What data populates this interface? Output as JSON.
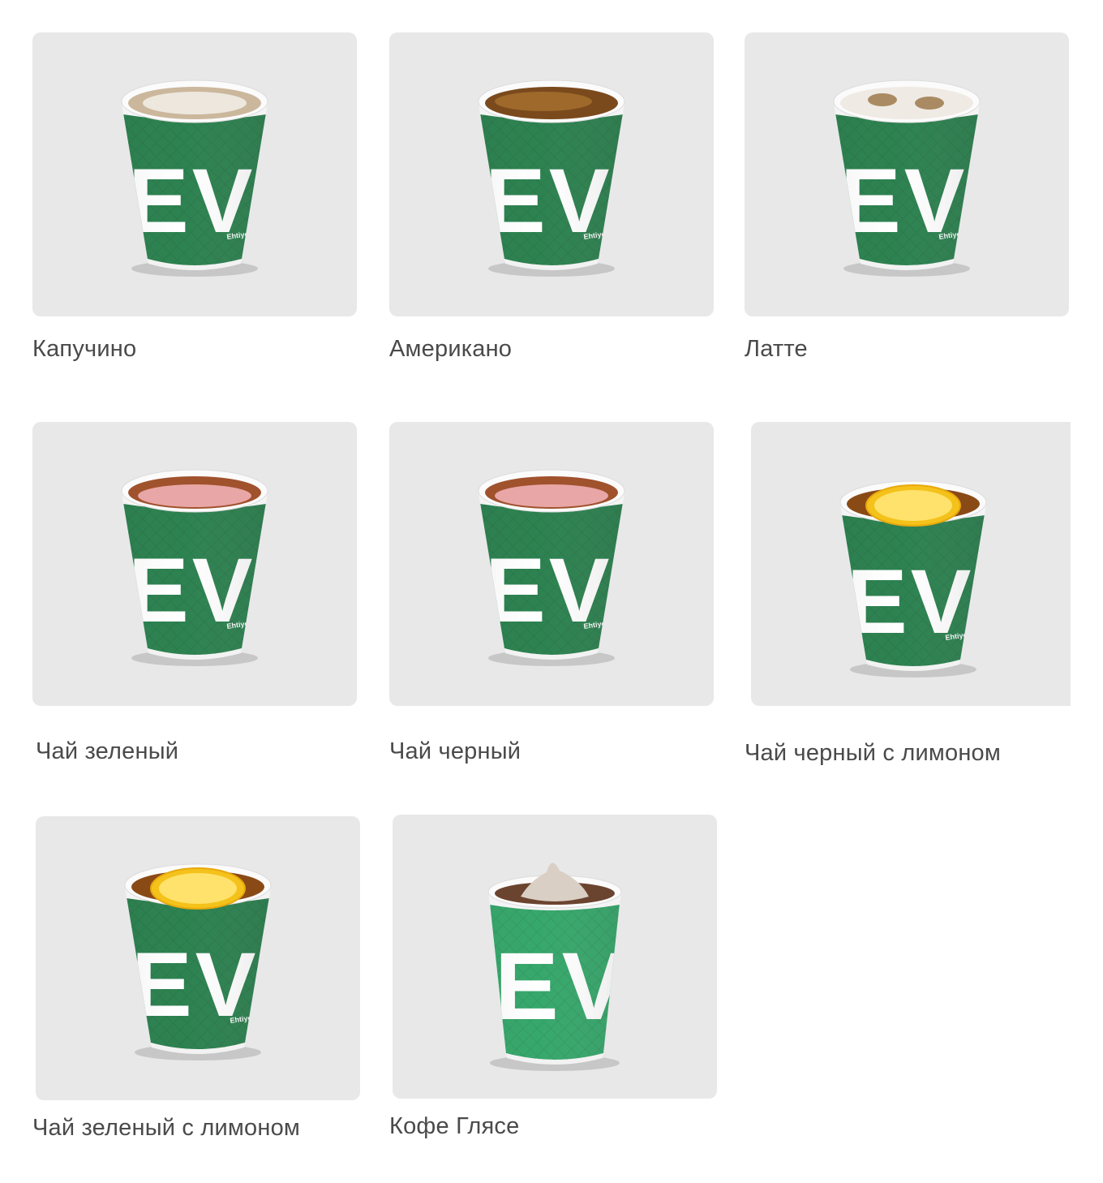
{
  "products": [
    {
      "name": "Капучино",
      "drink": "cappuccino",
      "cup": "classic"
    },
    {
      "name": "Американо",
      "drink": "americano",
      "cup": "classic"
    },
    {
      "name": "Латте",
      "drink": "latte",
      "cup": "classic"
    },
    {
      "name": "Чай зеленый",
      "drink": "tea",
      "cup": "classic"
    },
    {
      "name": "Чай черный",
      "drink": "tea",
      "cup": "classic"
    },
    {
      "name": "Чай черный с лимоном",
      "drink": "lemon-tea",
      "cup": "classic"
    },
    {
      "name": "Чай зеленый с лимоном",
      "drink": "lemon-tea",
      "cup": "classic"
    },
    {
      "name": "Кофе Глясе",
      "drink": "glace",
      "cup": "tall"
    }
  ],
  "cup": {
    "brand_text": "EVO",
    "sleeve_text": "Ehtiyot bo'ling",
    "sleeve_color": "#1f7a45",
    "sleeve_color_light": "#2aa262"
  }
}
